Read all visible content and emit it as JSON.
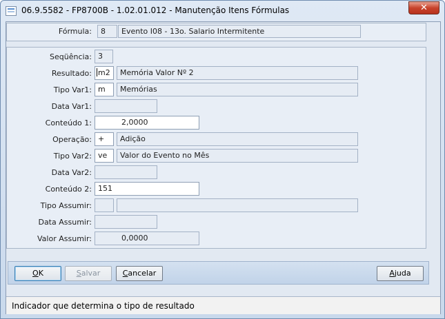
{
  "window": {
    "title": "06.9.5582 - FP8700B - 1.02.01.012 - Manutenção Itens Fórmulas",
    "close_glyph": "✕"
  },
  "header": {
    "formula_label": "Fórmula:",
    "formula_code": "8",
    "formula_description": "Evento I08 - 13o. Salario Intermitente"
  },
  "form": {
    "sequencia": {
      "label": "Seqüência:",
      "value": "3"
    },
    "resultado": {
      "label": "Resultado:",
      "code": "m2",
      "description": "Memória Valor Nº 2"
    },
    "tipo_var1": {
      "label": "Tipo Var1:",
      "code": "m",
      "description": "Memórias"
    },
    "data_var1": {
      "label": "Data Var1:",
      "value": ""
    },
    "conteudo1": {
      "label": "Conteúdo 1:",
      "value": "2,0000"
    },
    "operacao": {
      "label": "Operação:",
      "code": "+",
      "description": "Adição"
    },
    "tipo_var2": {
      "label": "Tipo Var2:",
      "code": "ve",
      "description": "Valor do Evento no Mês"
    },
    "data_var2": {
      "label": "Data Var2:",
      "value": ""
    },
    "conteudo2": {
      "label": "Conteúdo 2:",
      "value": "151"
    },
    "tipo_assumir": {
      "label": "Tipo Assumir:",
      "code": "",
      "description": ""
    },
    "data_assumir": {
      "label": "Data Assumir:",
      "value": ""
    },
    "valor_assumir": {
      "label": "Valor Assumir:",
      "value": "0,0000"
    }
  },
  "buttons": {
    "ok": {
      "mnemonic": "O",
      "rest": "K"
    },
    "salvar": {
      "mnemonic": "S",
      "rest": "alvar"
    },
    "cancelar": {
      "mnemonic": "C",
      "rest": "ancelar"
    },
    "ajuda": {
      "mnemonic": "A",
      "rest": "juda"
    }
  },
  "status_bar": {
    "text": "Indicador que determina o tipo de resultado"
  },
  "colors": {
    "close_button": "#c8432c",
    "panel_bg": "#e8eef6",
    "field_bg": "#e6ecf4",
    "button_bar": "#c9d9ec"
  },
  "icons": {
    "app": "form-window-icon",
    "close": "close-icon"
  }
}
